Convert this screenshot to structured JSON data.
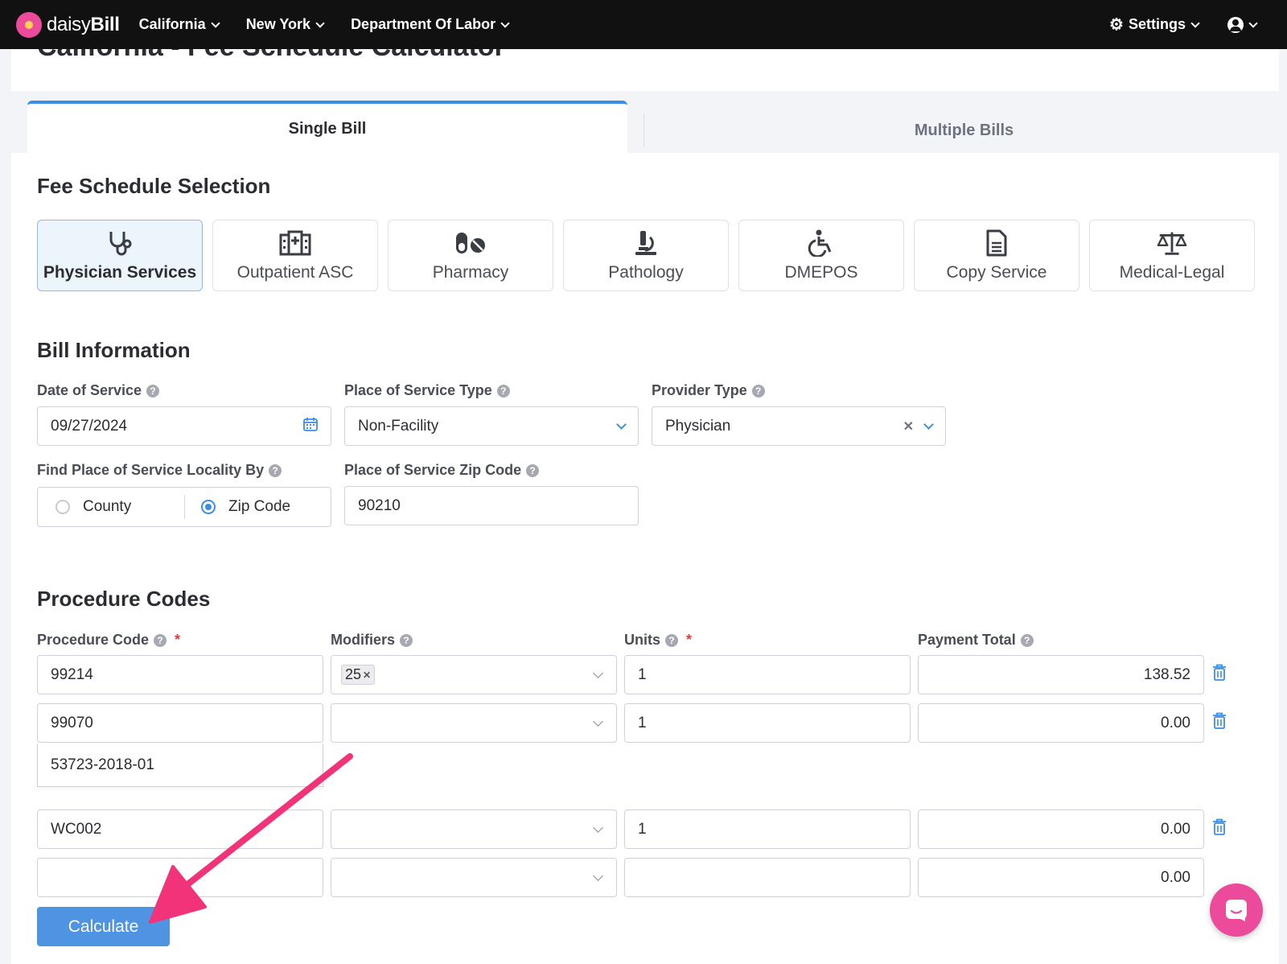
{
  "navbar": {
    "brand_light": "daisy",
    "brand_bold": "Bill",
    "menu": [
      "California",
      "New York",
      "Department Of Labor"
    ],
    "settings": "Settings"
  },
  "page": {
    "title": "California - Fee Schedule Calculator"
  },
  "tabs": {
    "single": "Single Bill",
    "multiple": "Multiple Bills"
  },
  "fee_schedule": {
    "title": "Fee Schedule Selection",
    "options": [
      {
        "label": "Physician Services",
        "icon": "stethoscope-icon",
        "selected": true
      },
      {
        "label": "Outpatient ASC",
        "icon": "hospital-icon",
        "selected": false
      },
      {
        "label": "Pharmacy",
        "icon": "pills-icon",
        "selected": false
      },
      {
        "label": "Pathology",
        "icon": "microscope-icon",
        "selected": false
      },
      {
        "label": "DMEPOS",
        "icon": "wheelchair-icon",
        "selected": false
      },
      {
        "label": "Copy Service",
        "icon": "document-icon",
        "selected": false
      },
      {
        "label": "Medical-Legal",
        "icon": "scales-icon",
        "selected": false
      }
    ]
  },
  "bill_info": {
    "title": "Bill Information",
    "date_label": "Date of Service",
    "date_value": "09/27/2024",
    "pos_type_label": "Place of Service Type",
    "pos_type_value": "Non-Facility",
    "provider_label": "Provider Type",
    "provider_value": "Physician",
    "locality_label": "Find Place of Service Locality By",
    "locality_options": [
      "County",
      "Zip Code"
    ],
    "locality_selected": "Zip Code",
    "zip_label": "Place of Service Zip Code",
    "zip_value": "90210"
  },
  "procedures": {
    "title": "Procedure Codes",
    "headers": {
      "code": "Procedure Code",
      "modifiers": "Modifiers",
      "units": "Units",
      "total": "Payment Total"
    },
    "rows": [
      {
        "code": "99214",
        "modifier": "25",
        "units": "1",
        "total": "138.52"
      },
      {
        "code": "99070",
        "modifier": "",
        "units": "1",
        "total": "0.00"
      },
      {
        "code": "WC002",
        "modifier": "",
        "units": "1",
        "total": "0.00"
      },
      {
        "code": "",
        "modifier": "",
        "units": "",
        "total": "0.00"
      }
    ],
    "suggestion": "53723-2018-01",
    "calculate_label": "Calculate"
  },
  "colors": {
    "accent": "#3a8ee6",
    "button": "#4f93e3",
    "brand_pink": "#ec4a9b",
    "annotation_arrow": "#f2337a"
  }
}
